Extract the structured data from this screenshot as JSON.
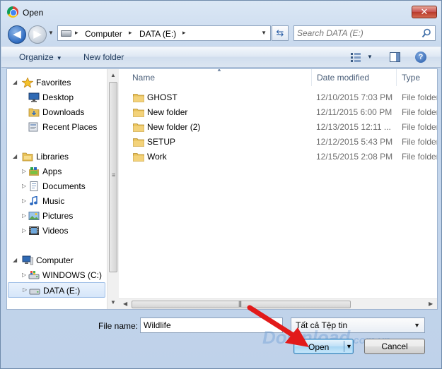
{
  "window": {
    "title": "Open",
    "close_glyph": "✕"
  },
  "address": {
    "segments": [
      "Computer",
      "DATA (E:)"
    ],
    "separator": "▸",
    "search_placeholder": "Search DATA (E:)"
  },
  "toolbar": {
    "organize": "Organize",
    "new_folder": "New folder"
  },
  "nav": {
    "favorites": "Favorites",
    "favorites_items": [
      "Desktop",
      "Downloads",
      "Recent Places"
    ],
    "libraries": "Libraries",
    "libraries_items": [
      "Apps",
      "Documents",
      "Music",
      "Pictures",
      "Videos"
    ],
    "computer": "Computer",
    "computer_items": [
      "WINDOWS (C:)",
      "DATA (E:)"
    ]
  },
  "columns": {
    "name": "Name",
    "date": "Date modified",
    "type": "Type"
  },
  "files": [
    {
      "name": "GHOST",
      "date": "12/10/2015 7:03 PM",
      "type": "File folder"
    },
    {
      "name": "New folder",
      "date": "12/11/2015 6:00 PM",
      "type": "File folder"
    },
    {
      "name": "New folder (2)",
      "date": "12/13/2015 12:11 ...",
      "type": "File folder"
    },
    {
      "name": "SETUP",
      "date": "12/12/2015 5:43 PM",
      "type": "File folder"
    },
    {
      "name": "Work",
      "date": "12/15/2015 2:08 PM",
      "type": "File folder"
    }
  ],
  "bottom": {
    "file_name_label": "File name:",
    "file_name_value": "Wildlife",
    "file_type": "Tất cả Tệp tin",
    "open": "Open",
    "cancel": "Cancel"
  },
  "watermark": {
    "main": "Download",
    "tld": ".com.vn"
  },
  "colors": {
    "accent": "#2e6bc0",
    "annotation_arrow": "#e21a1a",
    "folder": "#e8c25a"
  }
}
